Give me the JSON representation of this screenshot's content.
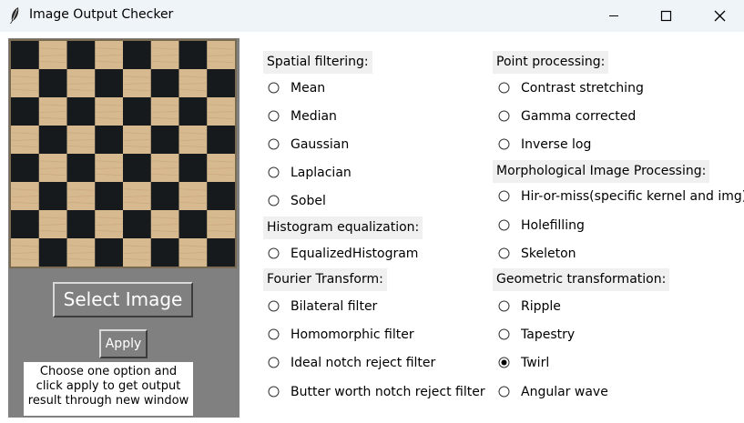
{
  "window": {
    "title": "Image Output Checker"
  },
  "left": {
    "select_label": "Select Image",
    "apply_label": "Apply",
    "instructions": [
      "Choose one option and",
      "click apply to get output",
      "result through new window"
    ],
    "board": {
      "rows": 8,
      "cols": 8,
      "dark_color": "#161a1d",
      "light_color": "#d7b98f",
      "frame_color": "#7a6a52"
    }
  },
  "options": {
    "spatial": {
      "heading": "Spatial filtering:",
      "items": [
        "Mean",
        "Median",
        "Gaussian",
        "Laplacian",
        "Sobel"
      ]
    },
    "histogram": {
      "heading": "Histogram equalization:",
      "items": [
        "EqualizedHistogram"
      ]
    },
    "fourier": {
      "heading": "Fourier Transform:",
      "items": [
        "Bilateral filter",
        "Homomorphic filter",
        "Ideal notch reject filter",
        "Butter worth notch reject filter"
      ]
    },
    "point": {
      "heading": "Point processing:",
      "items": [
        "Contrast stretching",
        "Gamma corrected",
        "Inverse log"
      ]
    },
    "morph": {
      "heading": "Morphological Image Processing:",
      "items": [
        "Hir-or-miss(specific kernel and img)",
        "Holefilling",
        "Skeleton"
      ]
    },
    "geometric": {
      "heading": "Geometric transformation:",
      "items": [
        "Ripple",
        "Tapestry",
        "Twirl",
        "Angular wave"
      ]
    },
    "selected": "Twirl"
  }
}
